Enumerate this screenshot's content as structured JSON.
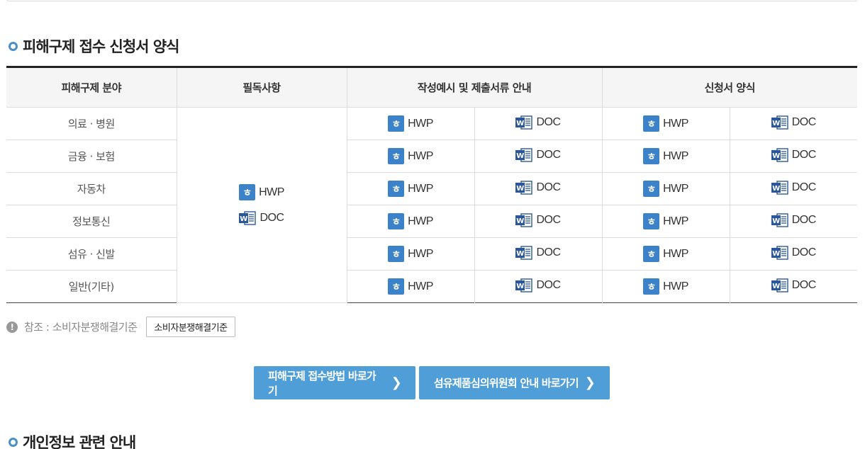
{
  "section1": {
    "title": "피해구제 접수 신청서 양식"
  },
  "table": {
    "headers": {
      "field": "피해구제 분야",
      "required": "필독사항",
      "examples": "작성예시 및 제출서류 안내",
      "forms": "신청서 양식"
    },
    "hwp_label": "HWP",
    "doc_label": "DOC",
    "rows": [
      {
        "field": "의료 · 병원"
      },
      {
        "field": "금융 · 보험"
      },
      {
        "field": "자동차"
      },
      {
        "field": "정보통신"
      },
      {
        "field": "섬유 · 신발"
      },
      {
        "field": "일반(기타)"
      }
    ]
  },
  "note": {
    "text": "참조 : 소비자분쟁해결기준",
    "button_label": "소비자분쟁해결기준"
  },
  "buttons": {
    "receipt_method": "피해구제 접수방법 바로가기",
    "textile_committee": "섬유제품심의위원회 안내 바로가기"
  },
  "section2": {
    "title": "개인정보 관련 안내"
  },
  "colors": {
    "accent": "#4f9ed8",
    "hwp": "#3b82c9",
    "doc": "#2b579a"
  }
}
